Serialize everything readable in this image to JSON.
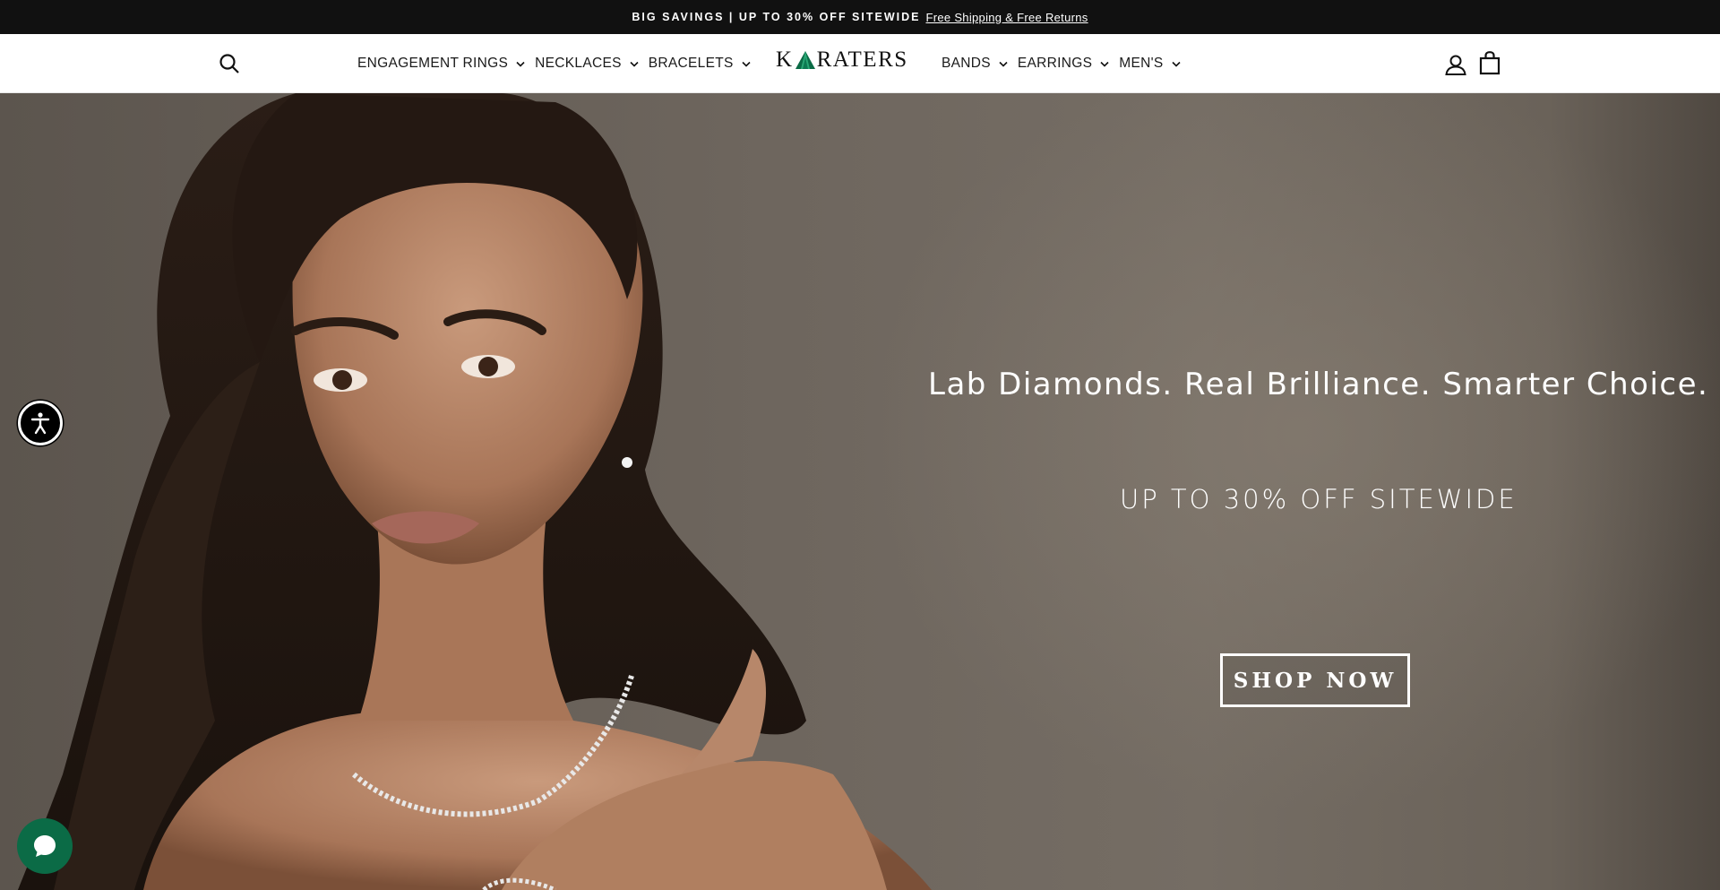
{
  "announcement": {
    "text": "BIG SAVINGS | UP TO 30% OFF SITEWIDE",
    "link": "Free Shipping & Free Returns"
  },
  "header": {
    "logo_k": "K",
    "logo_rest": "RATERS",
    "nav_left": [
      "ENGAGEMENT RINGS",
      "NECKLACES",
      "BRACELETS"
    ],
    "nav_right": [
      "BANDS",
      "EARRINGS",
      "MEN'S"
    ],
    "icons": [
      "search-icon",
      "account-icon",
      "cart-icon",
      "chevron-down-icon"
    ]
  },
  "hero": {
    "headline": "Lab Diamonds. Real Brilliance. Smarter Choice.",
    "subhead": "UP TO 30% OFF SITEWIDE",
    "cta": "SHOP NOW"
  },
  "widgets": {
    "accessibility": "accessibility-icon",
    "chat": "chat-icon"
  },
  "colors": {
    "announcement_bg": "#111111",
    "brand_green": "#0b6b46",
    "hero_bg": "#6e665e"
  }
}
